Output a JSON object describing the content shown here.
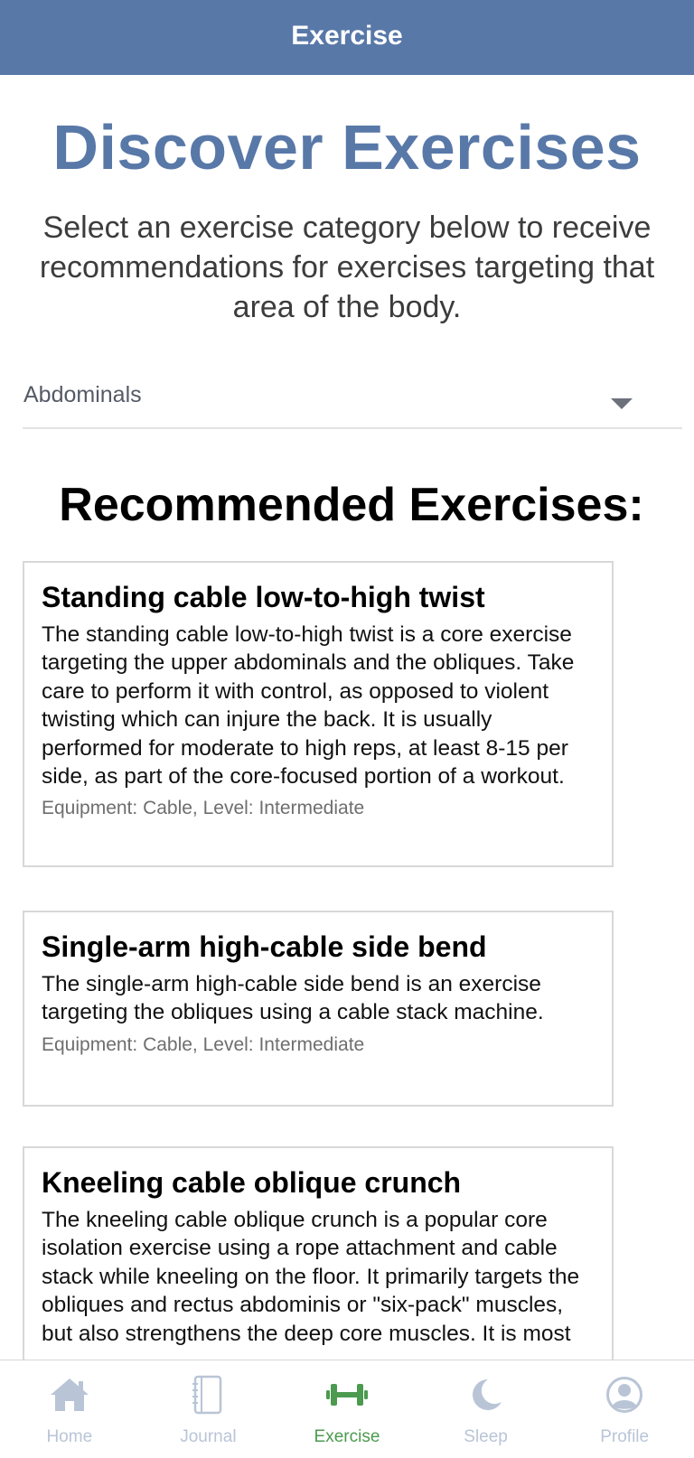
{
  "app": {
    "title": "Exercise"
  },
  "header": {
    "title": "Discover Exercises",
    "subtitle": "Select an exercise category below to receive recommendations for exercises targeting that area of the body."
  },
  "category_select": {
    "selected": "Abdominals"
  },
  "recommendations": {
    "heading": "Recommended Exercises:",
    "items": [
      {
        "title": "Standing cable low-to-high twist",
        "description": "The standing cable low-to-high twist is a core exercise targeting the upper abdominals and the obliques. Take care to perform it with control, as opposed to violent twisting which can injure the back. It is usually performed for moderate to high reps, at least 8-15 per side, as part of the core-focused portion of a workout.",
        "meta": "Equipment: Cable, Level: Intermediate"
      },
      {
        "title": "Single-arm high-cable side bend",
        "description": "The single-arm high-cable side bend is an exercise targeting the obliques using a cable stack machine.",
        "meta": "Equipment: Cable, Level: Intermediate"
      },
      {
        "title": "Kneeling cable oblique crunch",
        "description": "The kneeling cable oblique crunch is a popular core isolation exercise using a rope attachment and cable stack while kneeling on the floor. It primarily targets the obliques and rectus abdominis or \"six-pack\" muscles, but also strengthens the deep core muscles. It is most"
      }
    ]
  },
  "bottom_nav": {
    "items": [
      {
        "label": "Home",
        "icon": "home-icon",
        "active": false
      },
      {
        "label": "Journal",
        "icon": "journal-icon",
        "active": false
      },
      {
        "label": "Exercise",
        "icon": "dumbbell-icon",
        "active": true
      },
      {
        "label": "Sleep",
        "icon": "moon-icon",
        "active": false
      },
      {
        "label": "Profile",
        "icon": "profile-icon",
        "active": false
      }
    ]
  },
  "colors": {
    "brand": "#5878a8",
    "active_tab": "#4c9a4f",
    "inactive_tab": "#b9c5d6"
  }
}
